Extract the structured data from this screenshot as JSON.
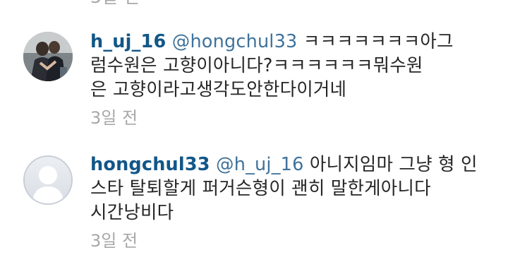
{
  "comments": [
    {
      "username": "h_uj_16",
      "mention": "@hongchul33",
      "lines": [
        "ㅋㅋㅋㅋㅋㅋㅋ아그",
        "럼수원은 고향이아니다?ㅋㅋㅋㅋㅋㅋ뭐수원",
        "은 고향이라고생각도안한다이거네"
      ],
      "timestamp": "3일 전",
      "avatar_icon": "photo-avatar-icon"
    },
    {
      "username": "hongchul33",
      "mention": "@h_uj_16",
      "lines": [
        "아니지임마 그냥 형 인",
        "스타 탈퇴할게 퍼거슨형이 괜히 말한게아니다",
        "시간낭비다"
      ],
      "timestamp": "3일 전",
      "avatar_icon": "default-user-avatar-icon"
    }
  ],
  "colors": {
    "username": "#125688",
    "mention": "#3f729b",
    "text": "#262626",
    "timestamp": "#a8a8a8"
  }
}
